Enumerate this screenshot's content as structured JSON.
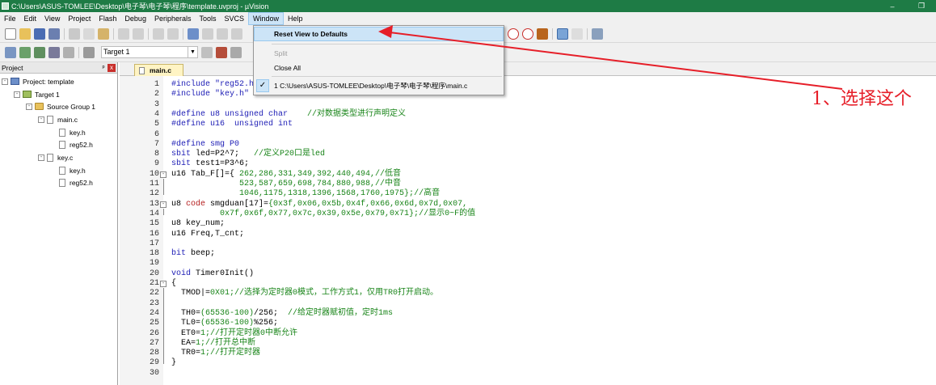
{
  "window": {
    "title": "C:\\Users\\ASUS-TOMLEE\\Desktop\\电子琴\\电子琴\\程序\\template.uvproj - µVision",
    "minimize": "–",
    "restore": "❐"
  },
  "menu": [
    "File",
    "Edit",
    "View",
    "Project",
    "Flash",
    "Debug",
    "Peripherals",
    "Tools",
    "SVCS",
    "Window",
    "Help"
  ],
  "toolbar": {
    "target_value": "Target 1"
  },
  "window_menu": {
    "items": [
      {
        "label": "Reset View to Defaults",
        "enabled": true,
        "highlighted": true
      },
      {
        "label": "Split",
        "enabled": false
      },
      {
        "label": "Close All",
        "enabled": true
      },
      {
        "label": "1 C:\\Users\\ASUS-TOMLEE\\Desktop\\电子琴\\电子琴\\程序\\main.c",
        "enabled": true,
        "checked": true
      }
    ],
    "check_mark": "✓"
  },
  "project_pane": {
    "title": "Project",
    "pin": "ᵖ",
    "close": "x",
    "tree": [
      {
        "label": "Project: template",
        "level": 0,
        "kind": "project",
        "expander": "⊟"
      },
      {
        "label": "Target 1",
        "level": 1,
        "kind": "target",
        "expander": "⊟"
      },
      {
        "label": "Source Group 1",
        "level": 2,
        "kind": "folder",
        "expander": "⊟"
      },
      {
        "label": "main.c",
        "level": 3,
        "kind": "file",
        "expander": "⊟"
      },
      {
        "label": "key.h",
        "level": 4,
        "kind": "file",
        "expander": ""
      },
      {
        "label": "reg52.h",
        "level": 4,
        "kind": "file",
        "expander": ""
      },
      {
        "label": "key.c",
        "level": 3,
        "kind": "file",
        "expander": "⊟"
      },
      {
        "label": "key.h",
        "level": 4,
        "kind": "file",
        "expander": ""
      },
      {
        "label": "reg52.h",
        "level": 4,
        "kind": "file",
        "expander": ""
      }
    ]
  },
  "editor": {
    "tab": "main.c",
    "lines": [
      [
        {
          "t": "#include \"reg52.h\"",
          "c": "#1d1db5"
        }
      ],
      [
        {
          "t": "#include \"key.h\"",
          "c": "#1d1db5"
        }
      ],
      [],
      [
        {
          "t": "#define u8 ",
          "c": "#1d1db5"
        },
        {
          "t": "unsigned char",
          "c": "#1d1db5"
        },
        {
          "t": "    //对数据类型进行声明定义",
          "c": "#188418"
        }
      ],
      [
        {
          "t": "#define u16  ",
          "c": "#1d1db5"
        },
        {
          "t": "unsigned int",
          "c": "#1d1db5"
        }
      ],
      [],
      [
        {
          "t": "#define smg P0",
          "c": "#1d1db5"
        }
      ],
      [
        {
          "t": "sbit ",
          "c": "#1d1db5"
        },
        {
          "t": "led=P2^7;",
          "c": "#000"
        },
        {
          "t": "   //定义P20口是led",
          "c": "#188418"
        }
      ],
      [
        {
          "t": "sbit ",
          "c": "#1d1db5"
        },
        {
          "t": "test1=P3^6;",
          "c": "#000"
        }
      ],
      [
        {
          "t": "u16 Tab_F[]={ ",
          "c": "#000"
        },
        {
          "t": "262,286,331,349,392,440,494,",
          "c": "#188418"
        },
        {
          "t": "//低音",
          "c": "#188418"
        }
      ],
      [
        {
          "t": "              ",
          "c": "#000"
        },
        {
          "t": "523,587,659,698,784,880,988,",
          "c": "#188418"
        },
        {
          "t": "//中音",
          "c": "#188418"
        }
      ],
      [
        {
          "t": "              ",
          "c": "#000"
        },
        {
          "t": "1046,1175,1318,1396,1568,1760,1975};",
          "c": "#188418"
        },
        {
          "t": "//高音",
          "c": "#188418"
        }
      ],
      [
        {
          "t": "u8 ",
          "c": "#000"
        },
        {
          "t": "code ",
          "c": "#b52020"
        },
        {
          "t": "smgduan[17]=",
          "c": "#000"
        },
        {
          "t": "{0x3f,0x06,0x5b,0x4f,0x66,0x6d,0x7d,0x07,",
          "c": "#188418"
        }
      ],
      [
        {
          "t": "          ",
          "c": "#000"
        },
        {
          "t": "0x7f,0x6f,0x77,0x7c,0x39,0x5e,0x79,0x71};",
          "c": "#188418"
        },
        {
          "t": "//显示0~F的值",
          "c": "#188418"
        }
      ],
      [
        {
          "t": "u8 key_num;",
          "c": "#000"
        }
      ],
      [
        {
          "t": "u16 Freq,T_cnt;",
          "c": "#000"
        }
      ],
      [],
      [
        {
          "t": "bit ",
          "c": "#1d1db5"
        },
        {
          "t": "beep;",
          "c": "#000"
        }
      ],
      [],
      [
        {
          "t": "void ",
          "c": "#1d1db5"
        },
        {
          "t": "Timer0Init()",
          "c": "#000"
        }
      ],
      [
        {
          "t": "{",
          "c": "#000"
        }
      ],
      [
        {
          "t": "  TMOD|=",
          "c": "#000"
        },
        {
          "t": "0X01",
          "c": "#188418"
        },
        {
          "t": ";//选择为定时器0模式，工作方式1，仅用TR0打开启动。",
          "c": "#188418"
        }
      ],
      [],
      [
        {
          "t": "  TH0=",
          "c": "#000"
        },
        {
          "t": "(65536-100)",
          "c": "#188418"
        },
        {
          "t": "/256;  ",
          "c": "#000"
        },
        {
          "t": "//给定时器赋初值，定时1ms",
          "c": "#188418"
        }
      ],
      [
        {
          "t": "  TL0=",
          "c": "#000"
        },
        {
          "t": "(65536-100)",
          "c": "#188418"
        },
        {
          "t": "%256;",
          "c": "#000"
        }
      ],
      [
        {
          "t": "  ET0=",
          "c": "#000"
        },
        {
          "t": "1",
          "c": "#188418"
        },
        {
          "t": ";//打开定时器0中断允许",
          "c": "#188418"
        }
      ],
      [
        {
          "t": "  EA=",
          "c": "#000"
        },
        {
          "t": "1",
          "c": "#188418"
        },
        {
          "t": ";//打开总中断",
          "c": "#188418"
        }
      ],
      [
        {
          "t": "  TR0=",
          "c": "#000"
        },
        {
          "t": "1",
          "c": "#188418"
        },
        {
          "t": ";//打开定时器",
          "c": "#188418"
        }
      ],
      [
        {
          "t": "}",
          "c": "#000"
        }
      ],
      []
    ]
  },
  "annotation": {
    "text": "1、选择这个",
    "color": "#e61e28"
  }
}
